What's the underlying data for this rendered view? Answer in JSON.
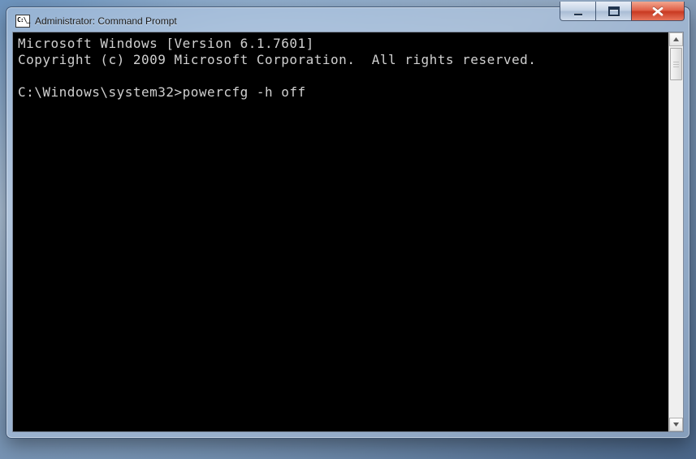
{
  "window": {
    "title": "Administrator: Command Prompt"
  },
  "console": {
    "line1": "Microsoft Windows [Version 6.1.7601]",
    "line2": "Copyright (c) 2009 Microsoft Corporation.  All rights reserved.",
    "blank": "",
    "prompt": "C:\\Windows\\system32>",
    "command": "powercfg -h off"
  }
}
